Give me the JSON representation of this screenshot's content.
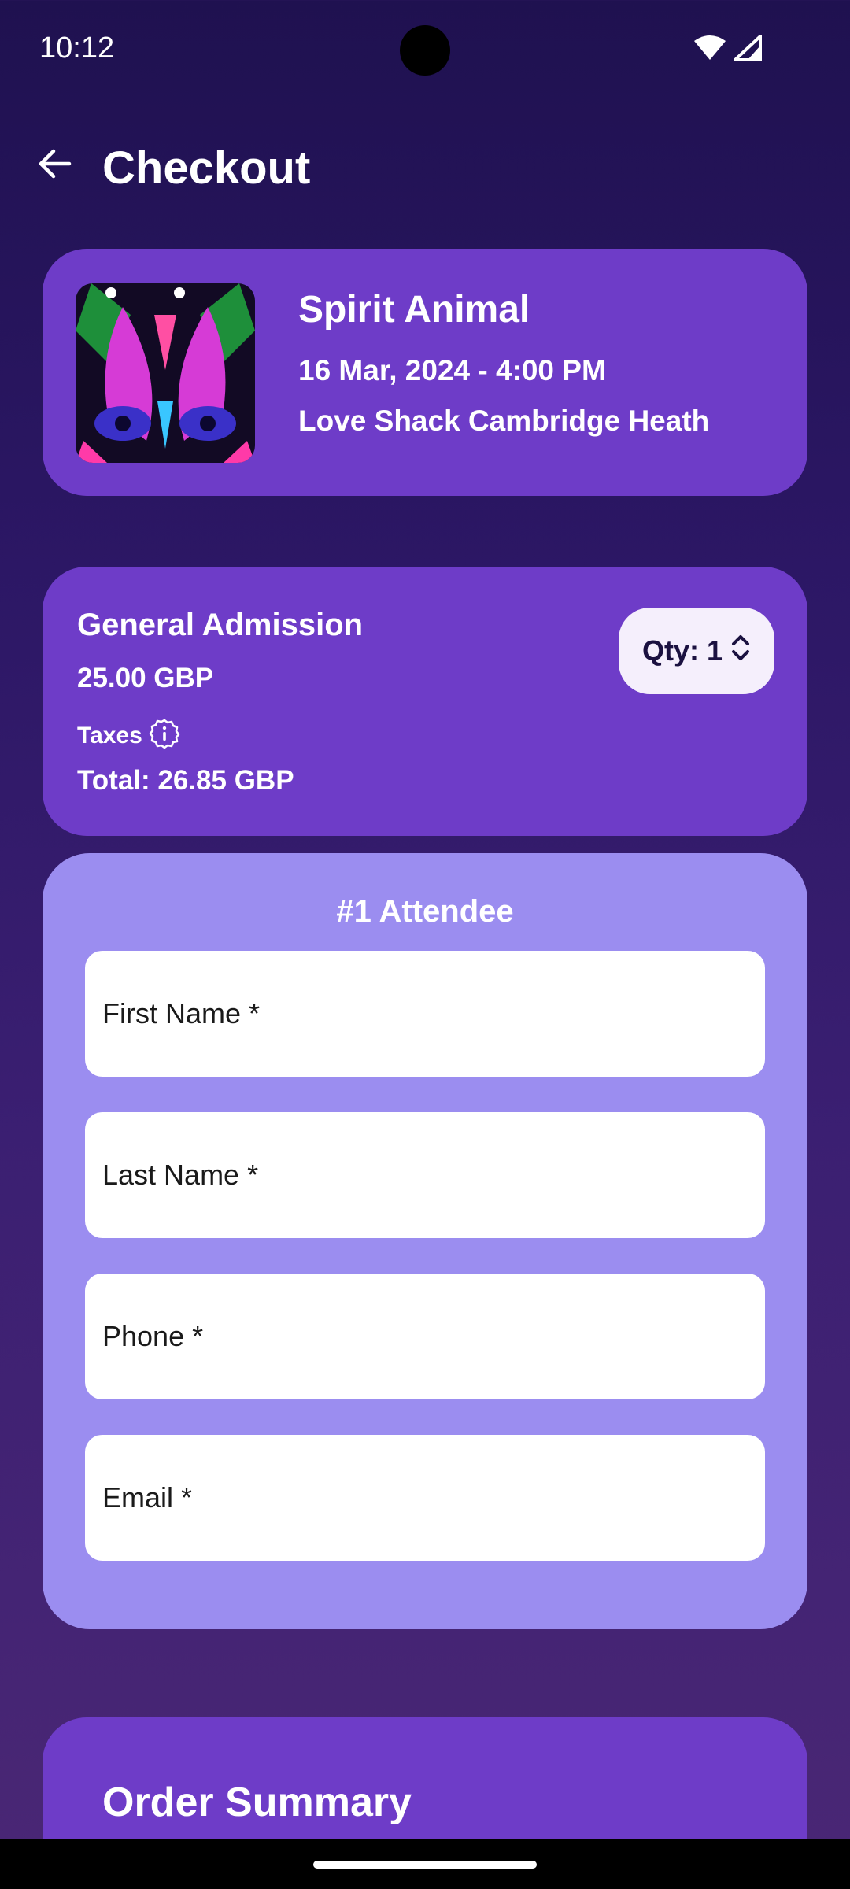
{
  "status_bar": {
    "time": "10:12"
  },
  "header": {
    "title": "Checkout"
  },
  "event": {
    "name": "Spirit Animal",
    "date": "16 Mar, 2024 - 4:00 PM",
    "venue": "Love Shack Cambridge Heath"
  },
  "ticket": {
    "name": "General Admission",
    "price": "25.00 GBP",
    "taxes_label": "Taxes",
    "total": "Total: 26.85 GBP",
    "qty_label": "Qty: 1"
  },
  "attendee": {
    "title": "#1 Attendee",
    "fields": [
      {
        "label": "First Name *"
      },
      {
        "label": "Last Name *"
      },
      {
        "label": "Phone *"
      },
      {
        "label": "Email *"
      }
    ]
  },
  "order_summary": {
    "title": "Order Summary"
  },
  "colors": {
    "card": "#6e3cc8",
    "attendee_card": "#9b8df0",
    "background_top": "#1f1150"
  }
}
